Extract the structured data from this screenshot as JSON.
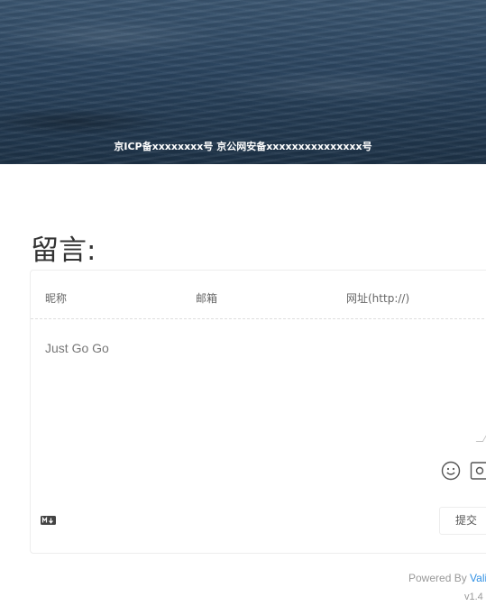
{
  "banner": {
    "icp_text": "京ICP备xxxxxxxx号 京公网安备xxxxxxxxxxxxxxx号"
  },
  "comments": {
    "heading": "留言:",
    "nick_placeholder": "昵称",
    "mail_placeholder": "邮箱",
    "link_placeholder": "网址(http://)",
    "textarea_value": "Just Go Go",
    "markdown_icon": "markdown-icon",
    "emoji_icon": "smiley-icon",
    "preview_icon": "preview-icon",
    "submit_label": "提交"
  },
  "footer": {
    "powered_prefix": "Powered By ",
    "powered_brand": "Valine",
    "version": "v1.4"
  },
  "colors": {
    "link_accent": "#3090e4",
    "banner_dark": "#1d3247"
  }
}
